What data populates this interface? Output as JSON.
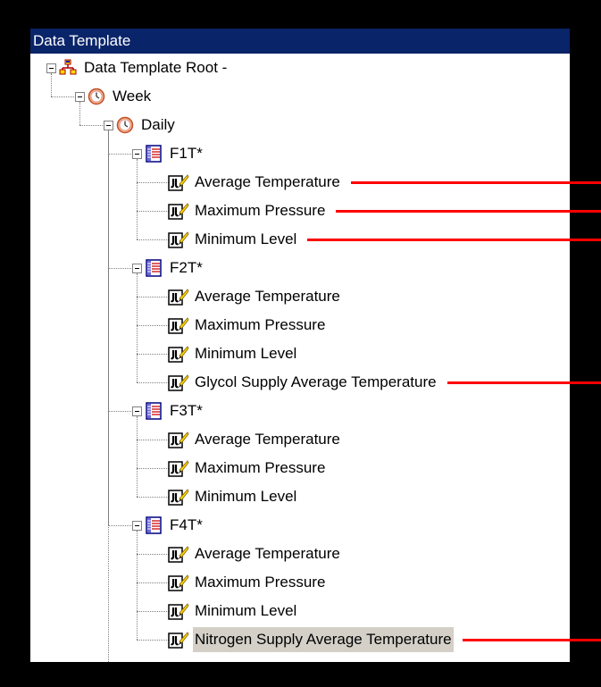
{
  "window": {
    "title": "Data Template"
  },
  "tree": {
    "root": {
      "label": "Data Template Root -",
      "icon": "data-template-root-icon"
    },
    "week": {
      "label": "Week",
      "icon": "clock-icon"
    },
    "daily": {
      "label": "Daily",
      "icon": "clock-icon"
    },
    "groups": [
      {
        "label": "F1T*",
        "icon": "table-icon",
        "items": [
          "Average Temperature",
          "Maximum Pressure",
          "Minimum Level"
        ]
      },
      {
        "label": "F2T*",
        "icon": "table-icon",
        "items": [
          "Average Temperature",
          "Maximum Pressure",
          "Minimum Level",
          "Glycol Supply Average Temperature"
        ]
      },
      {
        "label": "F3T*",
        "icon": "table-icon",
        "items": [
          "Average Temperature",
          "Maximum Pressure",
          "Minimum Level"
        ]
      },
      {
        "label": "F4T*",
        "icon": "table-icon",
        "items": [
          "Average Temperature",
          "Maximum Pressure",
          "Minimum Level",
          "Nitrogen Supply Average Temperature"
        ]
      }
    ],
    "item_icon": "tag-calculation-icon",
    "selected_item": "Nitrogen Supply Average Temperature"
  },
  "colors": {
    "titlebar": "#0a246a",
    "annotation": "#ff0000",
    "selection": "#d4d0c8"
  }
}
